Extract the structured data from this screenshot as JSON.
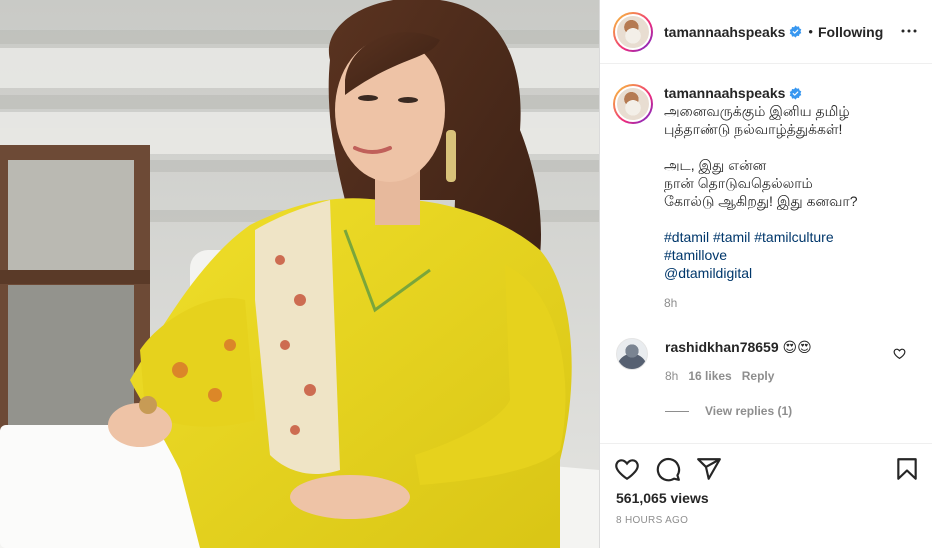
{
  "post": {
    "username": "tamannaahspeaks",
    "following_label": "Following",
    "separator": "•",
    "caption": {
      "lines_block1": [
        "அனைவருக்கும் இனிய தமிழ்",
        "புத்தாண்டு நல்வாழ்த்துக்கள்!"
      ],
      "lines_block2": [
        "அட, இது என்ன",
        "நான் தொடுவதெல்லாம்",
        "கோல்டு ஆகிறது! இது கனவா?"
      ],
      "hashtags_line1": "#dtamil #tamil #tamilculture",
      "hashtags_line2": "#tamillove",
      "mention": "@dtamildigital",
      "time": "8h"
    },
    "comments": [
      {
        "username": "rashidkhan78659",
        "text": "😍😍",
        "time": "8h",
        "likes": "16 likes",
        "reply_label": "Reply",
        "view_replies": "View replies (1)"
      }
    ],
    "views": "561,065 views",
    "posted_ago": "8 HOURS AGO"
  },
  "icons": {
    "verified": "verified-badge-icon",
    "more": "more-options-icon",
    "like": "heart-icon",
    "comment": "comment-icon",
    "share": "share-icon",
    "save": "bookmark-icon"
  },
  "colors": {
    "verified_blue": "#3897f0",
    "link": "#00376b",
    "muted": "#8e8e8e",
    "dress_yellow": "#e8d51c"
  }
}
